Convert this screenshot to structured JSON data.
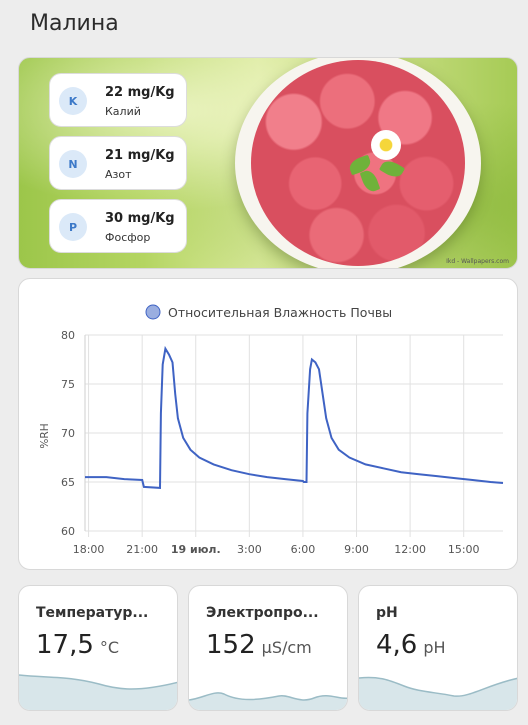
{
  "page": {
    "title": "Малина"
  },
  "picture": {
    "watermark": "Ikd - Wallpapers.com",
    "nutrients": [
      {
        "letter": "K",
        "value": "22 mg/Kg",
        "name": "Калий"
      },
      {
        "letter": "N",
        "value": "21 mg/Kg",
        "name": "Азот"
      },
      {
        "letter": "P",
        "value": "30 mg/Kg",
        "name": "Фосфор"
      }
    ]
  },
  "chart_data": {
    "type": "line",
    "title": "",
    "legend": "Относительная Влажность Почвы",
    "ylabel": "%RH",
    "xlabel": "",
    "ylim": [
      60,
      80
    ],
    "yticks": [
      "60",
      "65",
      "70",
      "75",
      "80"
    ],
    "xticks": [
      "18:00",
      "21:00",
      "19 июл.",
      "3:00",
      "6:00",
      "9:00",
      "12:00",
      "15:00"
    ],
    "xrange_hours": [
      17.8,
      41.2
    ],
    "color": "#3f63c4",
    "series": [
      {
        "name": "Относительная Влажность Почвы",
        "points": [
          [
            17.8,
            65.5
          ],
          [
            19.0,
            65.5
          ],
          [
            20.0,
            65.3
          ],
          [
            21.0,
            65.2
          ],
          [
            21.1,
            64.5
          ],
          [
            22.0,
            64.4
          ],
          [
            22.05,
            72.0
          ],
          [
            22.15,
            77.0
          ],
          [
            22.3,
            78.6
          ],
          [
            22.5,
            78.0
          ],
          [
            22.7,
            77.2
          ],
          [
            22.85,
            74.0
          ],
          [
            23.0,
            71.5
          ],
          [
            23.3,
            69.5
          ],
          [
            23.7,
            68.3
          ],
          [
            24.2,
            67.5
          ],
          [
            25.0,
            66.8
          ],
          [
            26.0,
            66.2
          ],
          [
            27.0,
            65.8
          ],
          [
            28.0,
            65.5
          ],
          [
            29.0,
            65.3
          ],
          [
            30.0,
            65.1
          ],
          [
            30.05,
            65.0
          ],
          [
            30.2,
            65.0
          ],
          [
            30.25,
            72.0
          ],
          [
            30.4,
            76.5
          ],
          [
            30.5,
            77.5
          ],
          [
            30.7,
            77.2
          ],
          [
            30.9,
            76.5
          ],
          [
            31.1,
            74.0
          ],
          [
            31.3,
            71.5
          ],
          [
            31.6,
            69.5
          ],
          [
            32.0,
            68.3
          ],
          [
            32.6,
            67.5
          ],
          [
            33.5,
            66.8
          ],
          [
            34.5,
            66.4
          ],
          [
            35.5,
            66.0
          ],
          [
            36.5,
            65.8
          ],
          [
            37.5,
            65.6
          ],
          [
            38.5,
            65.4
          ],
          [
            39.5,
            65.2
          ],
          [
            40.5,
            65.0
          ],
          [
            41.2,
            64.9
          ]
        ]
      }
    ]
  },
  "sensors": [
    {
      "name": "Температур...",
      "value": "17,5",
      "unit": "°C"
    },
    {
      "name": "Электропро...",
      "value": "152",
      "unit": "µS/cm"
    },
    {
      "name": "pH",
      "value": "4,6",
      "unit": "pH"
    }
  ]
}
